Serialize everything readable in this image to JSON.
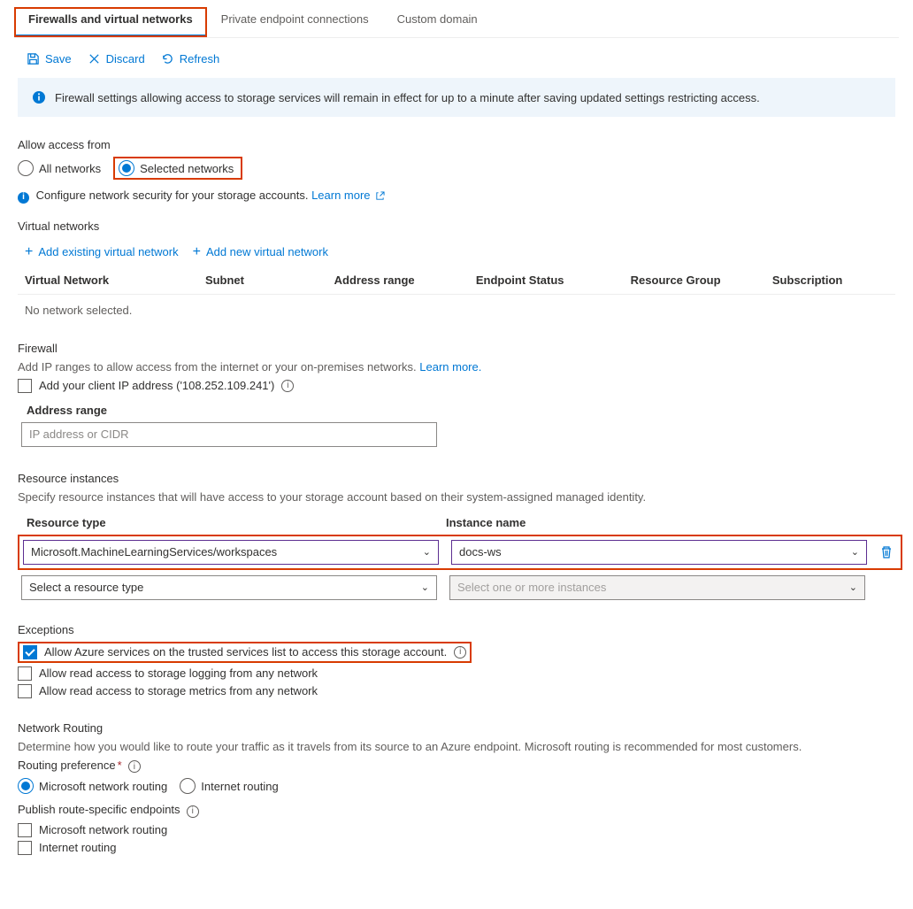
{
  "tabs": {
    "firewalls": "Firewalls and virtual networks",
    "private_endpoints": "Private endpoint connections",
    "custom_domain": "Custom domain"
  },
  "toolbar": {
    "save": "Save",
    "discard": "Discard",
    "refresh": "Refresh"
  },
  "info_banner": "Firewall settings allowing access to storage services will remain in effect for up to a minute after saving updated settings restricting access.",
  "access": {
    "label": "Allow access from",
    "all": "All networks",
    "selected": "Selected networks",
    "configure": "Configure network security for your storage accounts.",
    "learn_more": "Learn more"
  },
  "vnet": {
    "heading": "Virtual networks",
    "add_existing": "Add existing virtual network",
    "add_new": "Add new virtual network",
    "cols": {
      "network": "Virtual Network",
      "subnet": "Subnet",
      "address": "Address range",
      "endpoint": "Endpoint Status",
      "rg": "Resource Group",
      "sub": "Subscription"
    },
    "empty": "No network selected."
  },
  "firewall": {
    "heading": "Firewall",
    "desc_prefix": "Add IP ranges to allow access from the internet or your on-premises networks.",
    "learn_more": "Learn more.",
    "client_ip": "Add your client IP address ('108.252.109.241')",
    "addr_label": "Address range",
    "addr_placeholder": "IP address or CIDR"
  },
  "ri": {
    "heading": "Resource instances",
    "desc": "Specify resource instances that will have access to your storage account based on their system-assigned managed identity.",
    "col_type": "Resource type",
    "col_name": "Instance name",
    "type_value": "Microsoft.MachineLearningServices/workspaces",
    "name_value": "docs-ws",
    "type_placeholder": "Select a resource type",
    "name_placeholder": "Select one or more instances"
  },
  "exceptions": {
    "heading": "Exceptions",
    "trusted": "Allow Azure services on the trusted services list to access this storage account.",
    "logging": "Allow read access to storage logging from any network",
    "metrics": "Allow read access to storage metrics from any network"
  },
  "routing": {
    "heading": "Network Routing",
    "desc": "Determine how you would like to route your traffic as it travels from its source to an Azure endpoint. Microsoft routing is recommended for most customers.",
    "pref_label": "Routing preference",
    "ms_routing": "Microsoft network routing",
    "inet_routing": "Internet routing",
    "publish_label": "Publish route-specific endpoints",
    "ms_routing_chk": "Microsoft network routing",
    "inet_routing_chk": "Internet routing"
  }
}
